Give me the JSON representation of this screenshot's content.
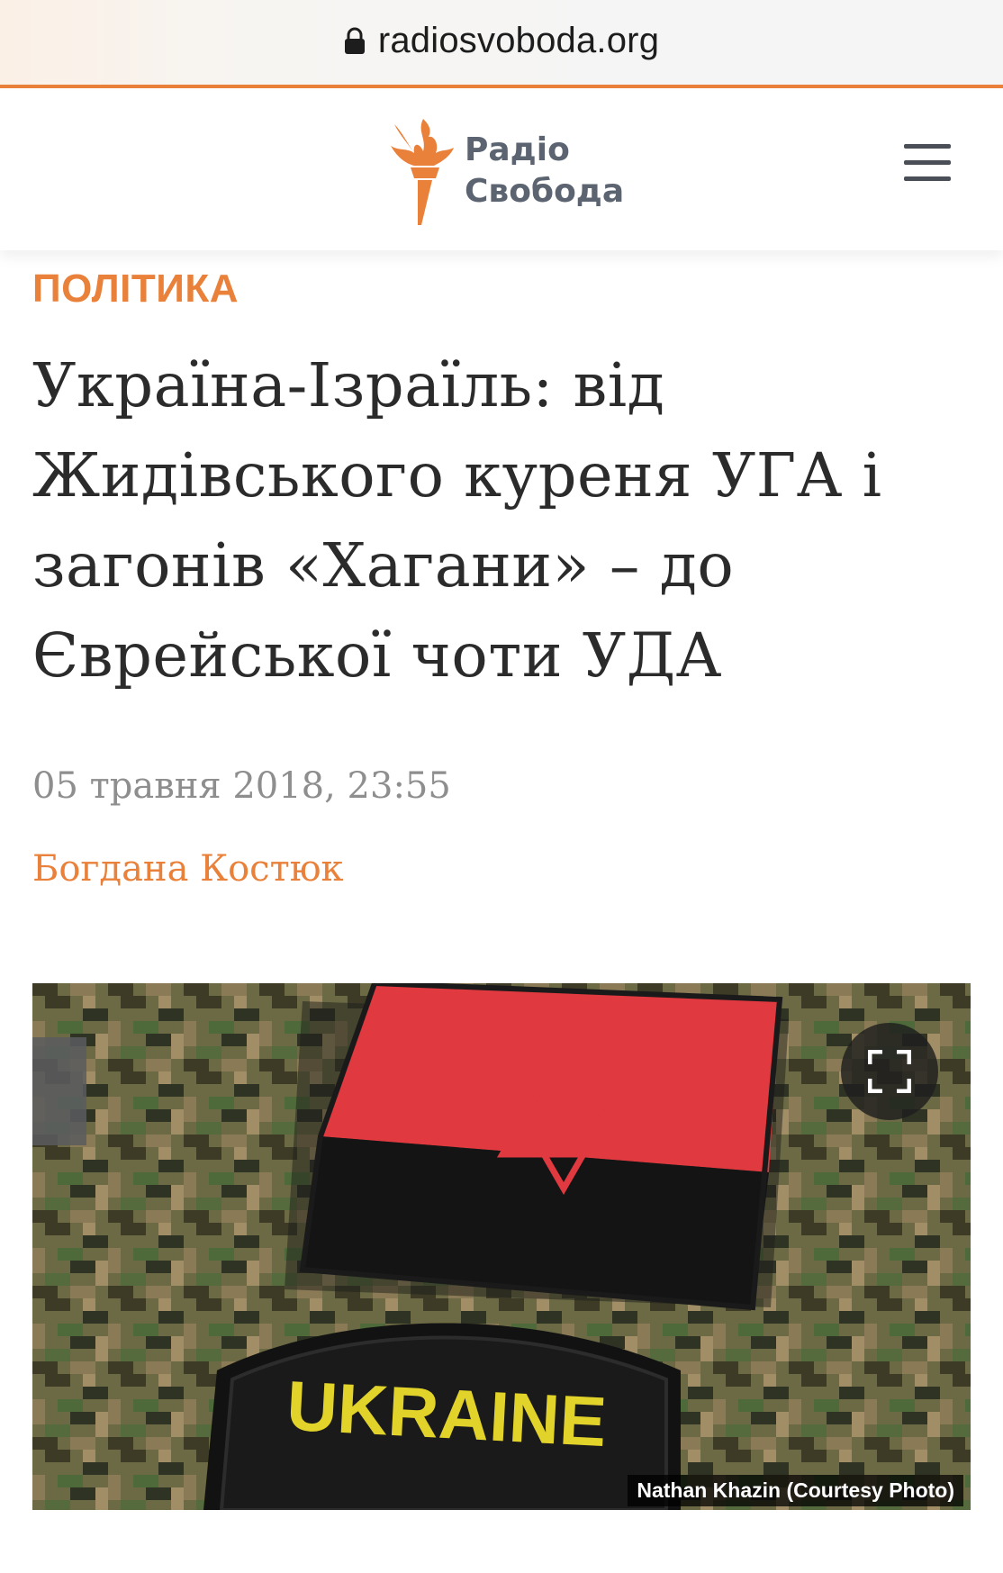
{
  "browser": {
    "url": "radiosvoboda.org",
    "lock_icon": "lock-icon"
  },
  "header": {
    "logo_line1": "Радіо",
    "logo_line2": "Свобода",
    "logo_icon": "torch-icon",
    "menu_icon": "hamburger-menu-icon"
  },
  "article": {
    "category": "ПОЛІТИКА",
    "title": "Україна-Ізраїль: від Жидівського куреня УГА і загонів «Хагани» – до Єврейської чоти УДА",
    "date": "05 травня 2018, 23:55",
    "author": "Богдана Костюк",
    "photo": {
      "patch_text": "UKRAINE",
      "credit": "Nathan Khazin (Courtesy Photo)",
      "expand_icon": "fullscreen-expand-icon"
    }
  },
  "colors": {
    "accent": "#e9813a",
    "title_text": "#2b2b2b",
    "date_text": "#8e8e8e",
    "patch_red": "#e0393f",
    "patch_black": "#141414",
    "patch_yellow": "#e2d32a"
  }
}
